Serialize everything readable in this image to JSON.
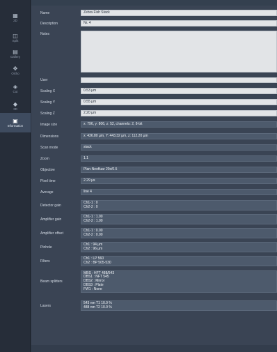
{
  "sidebar": {
    "items": [
      {
        "label": "2D",
        "icon": "grid-icon",
        "glyph": "▦",
        "active": false
      },
      {
        "label": "Split",
        "icon": "split-icon",
        "glyph": "◫",
        "active": false
      },
      {
        "label": "Gallery",
        "icon": "gallery-icon",
        "glyph": "▤",
        "active": false
      },
      {
        "label": "Ortho",
        "icon": "ortho-icon",
        "glyph": "✥",
        "active": false
      },
      {
        "label": "Cut",
        "icon": "cut-icon",
        "glyph": "◈",
        "active": false
      },
      {
        "label": "3D",
        "icon": "cube-3d-icon",
        "glyph": "◆",
        "active": false
      },
      {
        "label": "Information",
        "icon": "info-icon",
        "glyph": "▣",
        "active": true
      }
    ]
  },
  "info": {
    "name_label": "Name",
    "name_value": "Zebra Fish Stack",
    "description_label": "Description",
    "description_value": "Nr. 4",
    "notes_label": "Notes",
    "notes_value": "",
    "user_label": "User",
    "user_value": "",
    "scaling_x_label": "Scaling X",
    "scaling_x_value": "0.53 µm",
    "scaling_y_label": "Scaling Y",
    "scaling_y_value": "0.55 µm",
    "scaling_z_label": "Scaling Z",
    "scaling_z_value": "2.20 µm",
    "image_size_label": "Image size",
    "image_size_value": "x: 796, y: 806, z: 52, channels: 2, 8-bit",
    "dimensions_label": "Dimensions",
    "dimensions_value": "x: 436.80 µm, Y: 443.32 µm, z: 112.20 µm",
    "scan_mode_label": "Scan mode",
    "scan_mode_value": "stack",
    "zoom_label": "Zoom",
    "zoom_value": "1.1",
    "objective_label": "Objective",
    "objective_value": "Plan-Neofluar 20x/0.5",
    "pixel_time_label": "Pixel time",
    "pixel_time_value": "2.29 µs",
    "average_label": "Average",
    "average_value": "line 4",
    "detector_gain_label": "Detector gain",
    "detector_gain_values": [
      "Ch1-1 : 0",
      "Ch2-2 : 0"
    ],
    "amplifier_gain_label": "Amplifier gain",
    "amplifier_gain_values": [
      "Ch1-1 : 1.00",
      "Ch2-2 : 1.00"
    ],
    "amplifier_offset_label": "Amplifier offset",
    "amplifier_offset_values": [
      "Ch1-1 : 0.00",
      "Ch2-2 : 0.00"
    ],
    "pinhole_label": "Pinhole",
    "pinhole_values": [
      "Ch1 : 94 µm",
      "Ch2 : 96 µm"
    ],
    "filters_label": "Filters",
    "filters_values": [
      "Ch1 : LP 560",
      "Ch2 : BP 505-530"
    ],
    "beam_splitters_label": "Beam splitters",
    "beam_splitters_values": [
      "MBS : HFT 488/543",
      "DBS1 : NFT 545",
      "DBS2 : Mirror",
      "DBS3 : Plate",
      "FW1 : None"
    ],
    "lasers_label": "Lasers",
    "lasers_values": [
      "543 nm T1 10.0 %",
      "488 nm T2 10.0 %"
    ]
  }
}
